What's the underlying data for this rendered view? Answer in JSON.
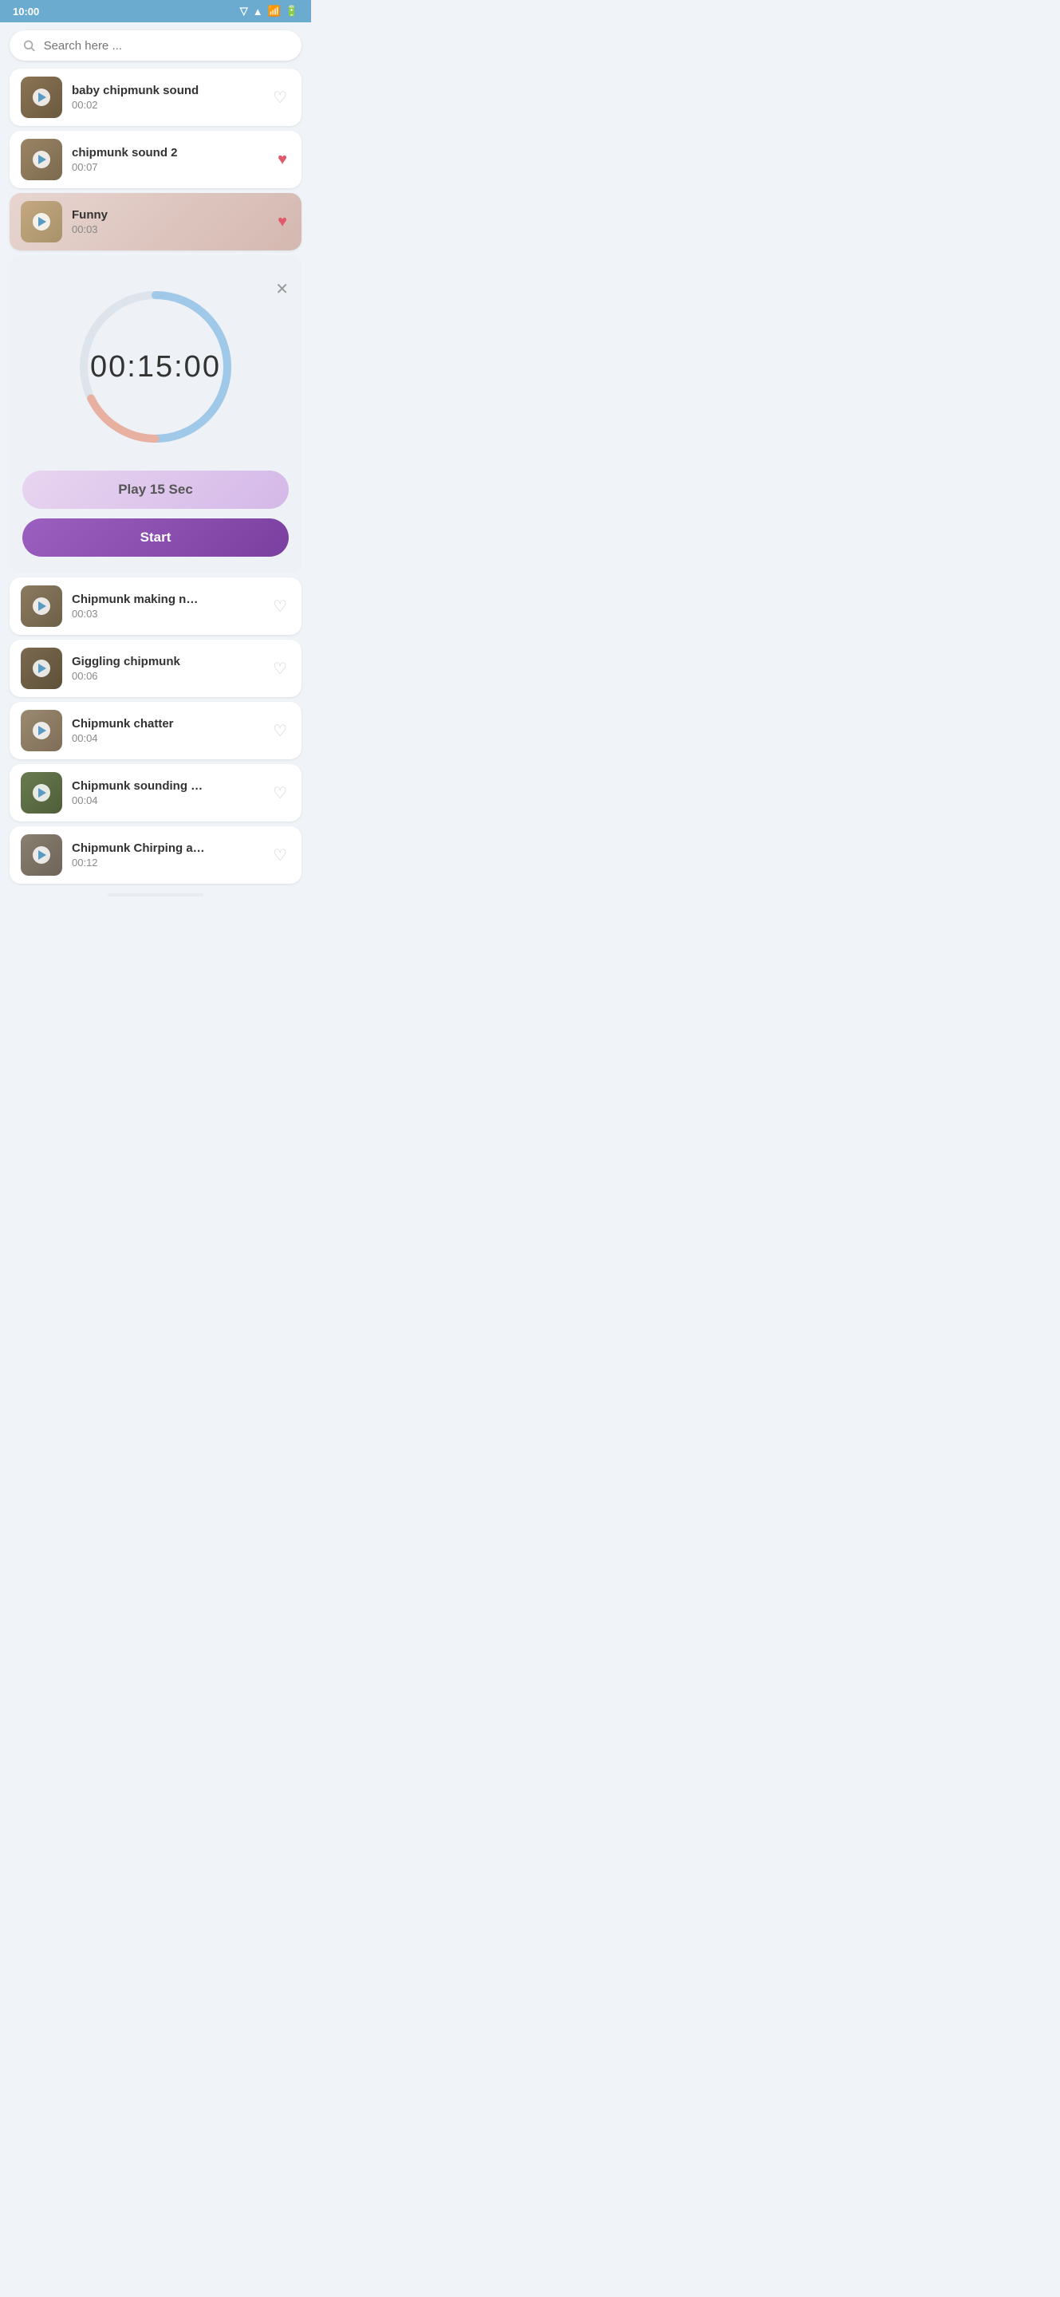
{
  "statusBar": {
    "time": "10:00",
    "icons": [
      "signal",
      "wifi",
      "battery"
    ]
  },
  "search": {
    "placeholder": "Search here ..."
  },
  "sounds": [
    {
      "id": 1,
      "title": "baby chipmunk sound",
      "duration": "00:02",
      "liked": false,
      "active": false,
      "thumbClass": "thumb-chipmunk-1"
    },
    {
      "id": 2,
      "title": "chipmunk sound 2",
      "duration": "00:07",
      "liked": true,
      "active": false,
      "thumbClass": "thumb-chipmunk-2"
    },
    {
      "id": 3,
      "title": "Funny",
      "duration": "00:03",
      "liked": true,
      "active": true,
      "thumbClass": "thumb-chipmunk-3"
    }
  ],
  "timer": {
    "display": "00:15:00",
    "play15Label": "Play 15 Sec",
    "startLabel": "Start",
    "circleBlueStroke": "#a0c8e8",
    "circlePinkStroke": "#e8b0a0"
  },
  "soundsBelow": [
    {
      "id": 4,
      "title": "Chipmunk making n…",
      "duration": "00:03",
      "liked": false,
      "thumbClass": "thumb-chipmunk-4"
    },
    {
      "id": 5,
      "title": "Giggling chipmunk",
      "duration": "00:06",
      "liked": false,
      "thumbClass": "thumb-chipmunk-5"
    },
    {
      "id": 6,
      "title": "Chipmunk chatter",
      "duration": "00:04",
      "liked": false,
      "thumbClass": "thumb-chipmunk-6"
    },
    {
      "id": 7,
      "title": "Chipmunk sounding …",
      "duration": "00:04",
      "liked": false,
      "thumbClass": "thumb-chipmunk-7"
    },
    {
      "id": 8,
      "title": "Chipmunk Chirping a…",
      "duration": "00:12",
      "liked": false,
      "thumbClass": "thumb-chipmunk-8"
    }
  ]
}
